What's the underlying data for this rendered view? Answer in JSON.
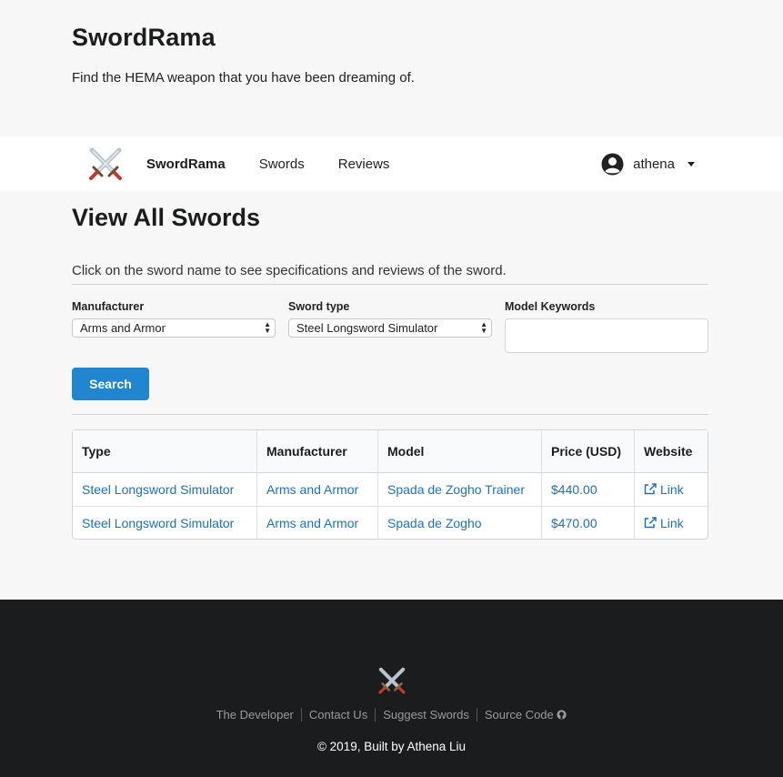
{
  "hero": {
    "title": "SwordRama",
    "subtitle": "Find the HEMA weapon that you have been dreaming of."
  },
  "nav": {
    "logo_icon": "crossed-swords-icon",
    "brand": "SwordRama",
    "links": [
      "Swords",
      "Reviews"
    ],
    "user_icon": "user-circle-icon",
    "user_name": "athena"
  },
  "main": {
    "heading": "View All Swords",
    "hint": "Click on the sword name to see specifications and reviews of the sword.",
    "filters": {
      "manufacturer_label": "Manufacturer",
      "manufacturer_value": "Arms and Armor",
      "type_label": "Sword type",
      "type_value": "Steel Longsword Simulator",
      "keywords_label": "Model Keywords",
      "keywords_value": ""
    },
    "search_label": "Search"
  },
  "table": {
    "headers": [
      "Type",
      "Manufacturer",
      "Model",
      "Price (USD)",
      "Website"
    ],
    "rows": [
      {
        "type": "Steel Longsword Simulator",
        "manufacturer": "Arms and Armor",
        "model": "Spada de Zogho Trainer",
        "price": "$440.00",
        "website": "Link"
      },
      {
        "type": "Steel Longsword Simulator",
        "manufacturer": "Arms and Armor",
        "model": "Spada de Zogho",
        "price": "$470.00",
        "website": "Link"
      }
    ]
  },
  "footer": {
    "logo_icon": "crossed-swords-icon",
    "links": [
      "The Developer",
      "Contact Us",
      "Suggest Swords",
      "Source Code"
    ],
    "source_icon": "github-icon",
    "copyright": "© 2019, Built by Athena Liu"
  },
  "colors": {
    "accent": "#2185d0",
    "link": "#1e70bf",
    "footer_bg": "#1b1c1d"
  }
}
